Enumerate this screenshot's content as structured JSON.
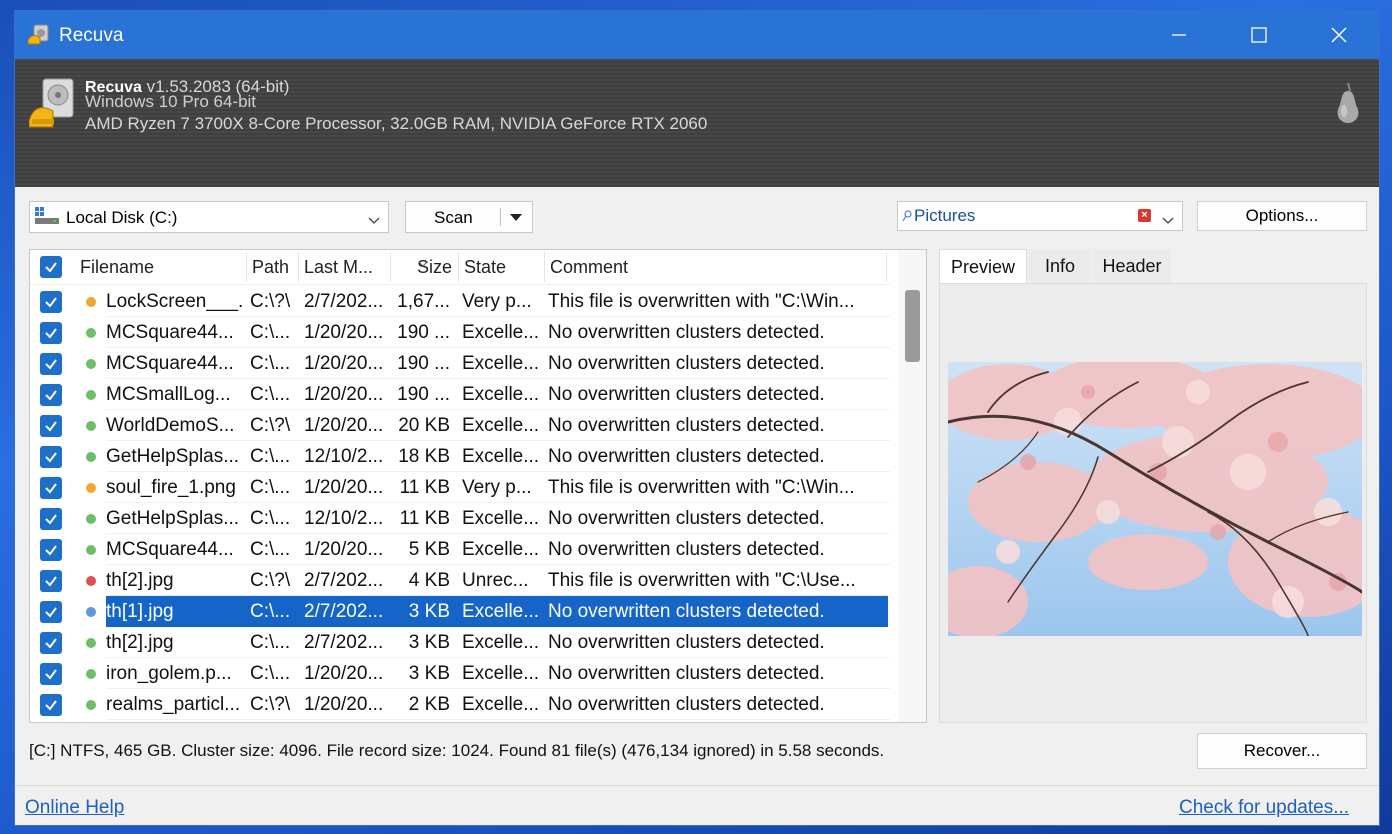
{
  "window": {
    "title": "Recuva"
  },
  "header": {
    "product": "Recuva",
    "version": "v1.53.2083 (64-bit)",
    "os": "Windows 10 Pro 64-bit",
    "hardware": "AMD Ryzen 7 3700X 8-Core Processor, 32.0GB RAM, NVIDIA GeForce RTX 2060"
  },
  "toolbar": {
    "drive": "Local Disk (C:)",
    "scan_label": "Scan",
    "filter_value": "Pictures",
    "options_label": "Options..."
  },
  "table": {
    "columns": [
      "Filename",
      "Path",
      "Last M...",
      "Size",
      "State",
      "Comment"
    ],
    "rows": [
      {
        "filename": "LockScreen___...",
        "path": "C:\\?\\",
        "modified": "2/7/202...",
        "size": "1,67...",
        "state": "Very p...",
        "comment": "This file is overwritten with \"C:\\Win...",
        "status": "orange"
      },
      {
        "filename": "MCSquare44...",
        "path": "C:\\...",
        "modified": "1/20/20...",
        "size": "190 ...",
        "state": "Excelle...",
        "comment": "No overwritten clusters detected.",
        "status": "green"
      },
      {
        "filename": "MCSquare44...",
        "path": "C:\\...",
        "modified": "1/20/20...",
        "size": "190 ...",
        "state": "Excelle...",
        "comment": "No overwritten clusters detected.",
        "status": "green"
      },
      {
        "filename": "MCSmallLog...",
        "path": "C:\\...",
        "modified": "1/20/20...",
        "size": "190 ...",
        "state": "Excelle...",
        "comment": "No overwritten clusters detected.",
        "status": "green"
      },
      {
        "filename": "WorldDemoS...",
        "path": "C:\\?\\",
        "modified": "1/20/20...",
        "size": "20 KB",
        "state": "Excelle...",
        "comment": "No overwritten clusters detected.",
        "status": "green"
      },
      {
        "filename": "GetHelpSplas...",
        "path": "C:\\...",
        "modified": "12/10/2...",
        "size": "18 KB",
        "state": "Excelle...",
        "comment": "No overwritten clusters detected.",
        "status": "green"
      },
      {
        "filename": "soul_fire_1.png",
        "path": "C:\\...",
        "modified": "1/20/20...",
        "size": "11 KB",
        "state": "Very p...",
        "comment": "This file is overwritten with \"C:\\Win...",
        "status": "orange"
      },
      {
        "filename": "GetHelpSplas...",
        "path": "C:\\...",
        "modified": "12/10/2...",
        "size": "11 KB",
        "state": "Excelle...",
        "comment": "No overwritten clusters detected.",
        "status": "green"
      },
      {
        "filename": "MCSquare44...",
        "path": "C:\\...",
        "modified": "1/20/20...",
        "size": "5 KB",
        "state": "Excelle...",
        "comment": "No overwritten clusters detected.",
        "status": "green"
      },
      {
        "filename": "th[2].jpg",
        "path": "C:\\?\\",
        "modified": "2/7/202...",
        "size": "4 KB",
        "state": "Unrec...",
        "comment": "This file is overwritten with \"C:\\Use...",
        "status": "red"
      },
      {
        "filename": "th[1].jpg",
        "path": "C:\\...",
        "modified": "2/7/202...",
        "size": "3 KB",
        "state": "Excelle...",
        "comment": "No overwritten clusters detected.",
        "status": "blue",
        "selected": true
      },
      {
        "filename": "th[2].jpg",
        "path": "C:\\...",
        "modified": "2/7/202...",
        "size": "3 KB",
        "state": "Excelle...",
        "comment": "No overwritten clusters detected.",
        "status": "green"
      },
      {
        "filename": "iron_golem.p...",
        "path": "C:\\...",
        "modified": "1/20/20...",
        "size": "3 KB",
        "state": "Excelle...",
        "comment": "No overwritten clusters detected.",
        "status": "green"
      },
      {
        "filename": "realms_particl...",
        "path": "C:\\?\\",
        "modified": "1/20/20...",
        "size": "2 KB",
        "state": "Excelle...",
        "comment": "No overwritten clusters detected.",
        "status": "green"
      }
    ]
  },
  "preview": {
    "tabs": [
      "Preview",
      "Info",
      "Header"
    ],
    "active_tab": "Preview"
  },
  "status": {
    "text": "[C:] NTFS, 465 GB. Cluster size: 4096. File record size: 1024. Found 81 file(s) (476,134 ignored) in 5.58 seconds."
  },
  "buttons": {
    "recover": "Recover..."
  },
  "footer": {
    "help_link": "Online Help",
    "update_link": "Check for updates..."
  },
  "colors": {
    "titlebar": "#2a73d6",
    "selection": "#1565c8",
    "checkbox": "#1e6fc8",
    "status_green": "#6dbf67",
    "status_orange": "#f0a630",
    "status_red": "#d9534f",
    "status_blue": "#5b9bd5"
  }
}
